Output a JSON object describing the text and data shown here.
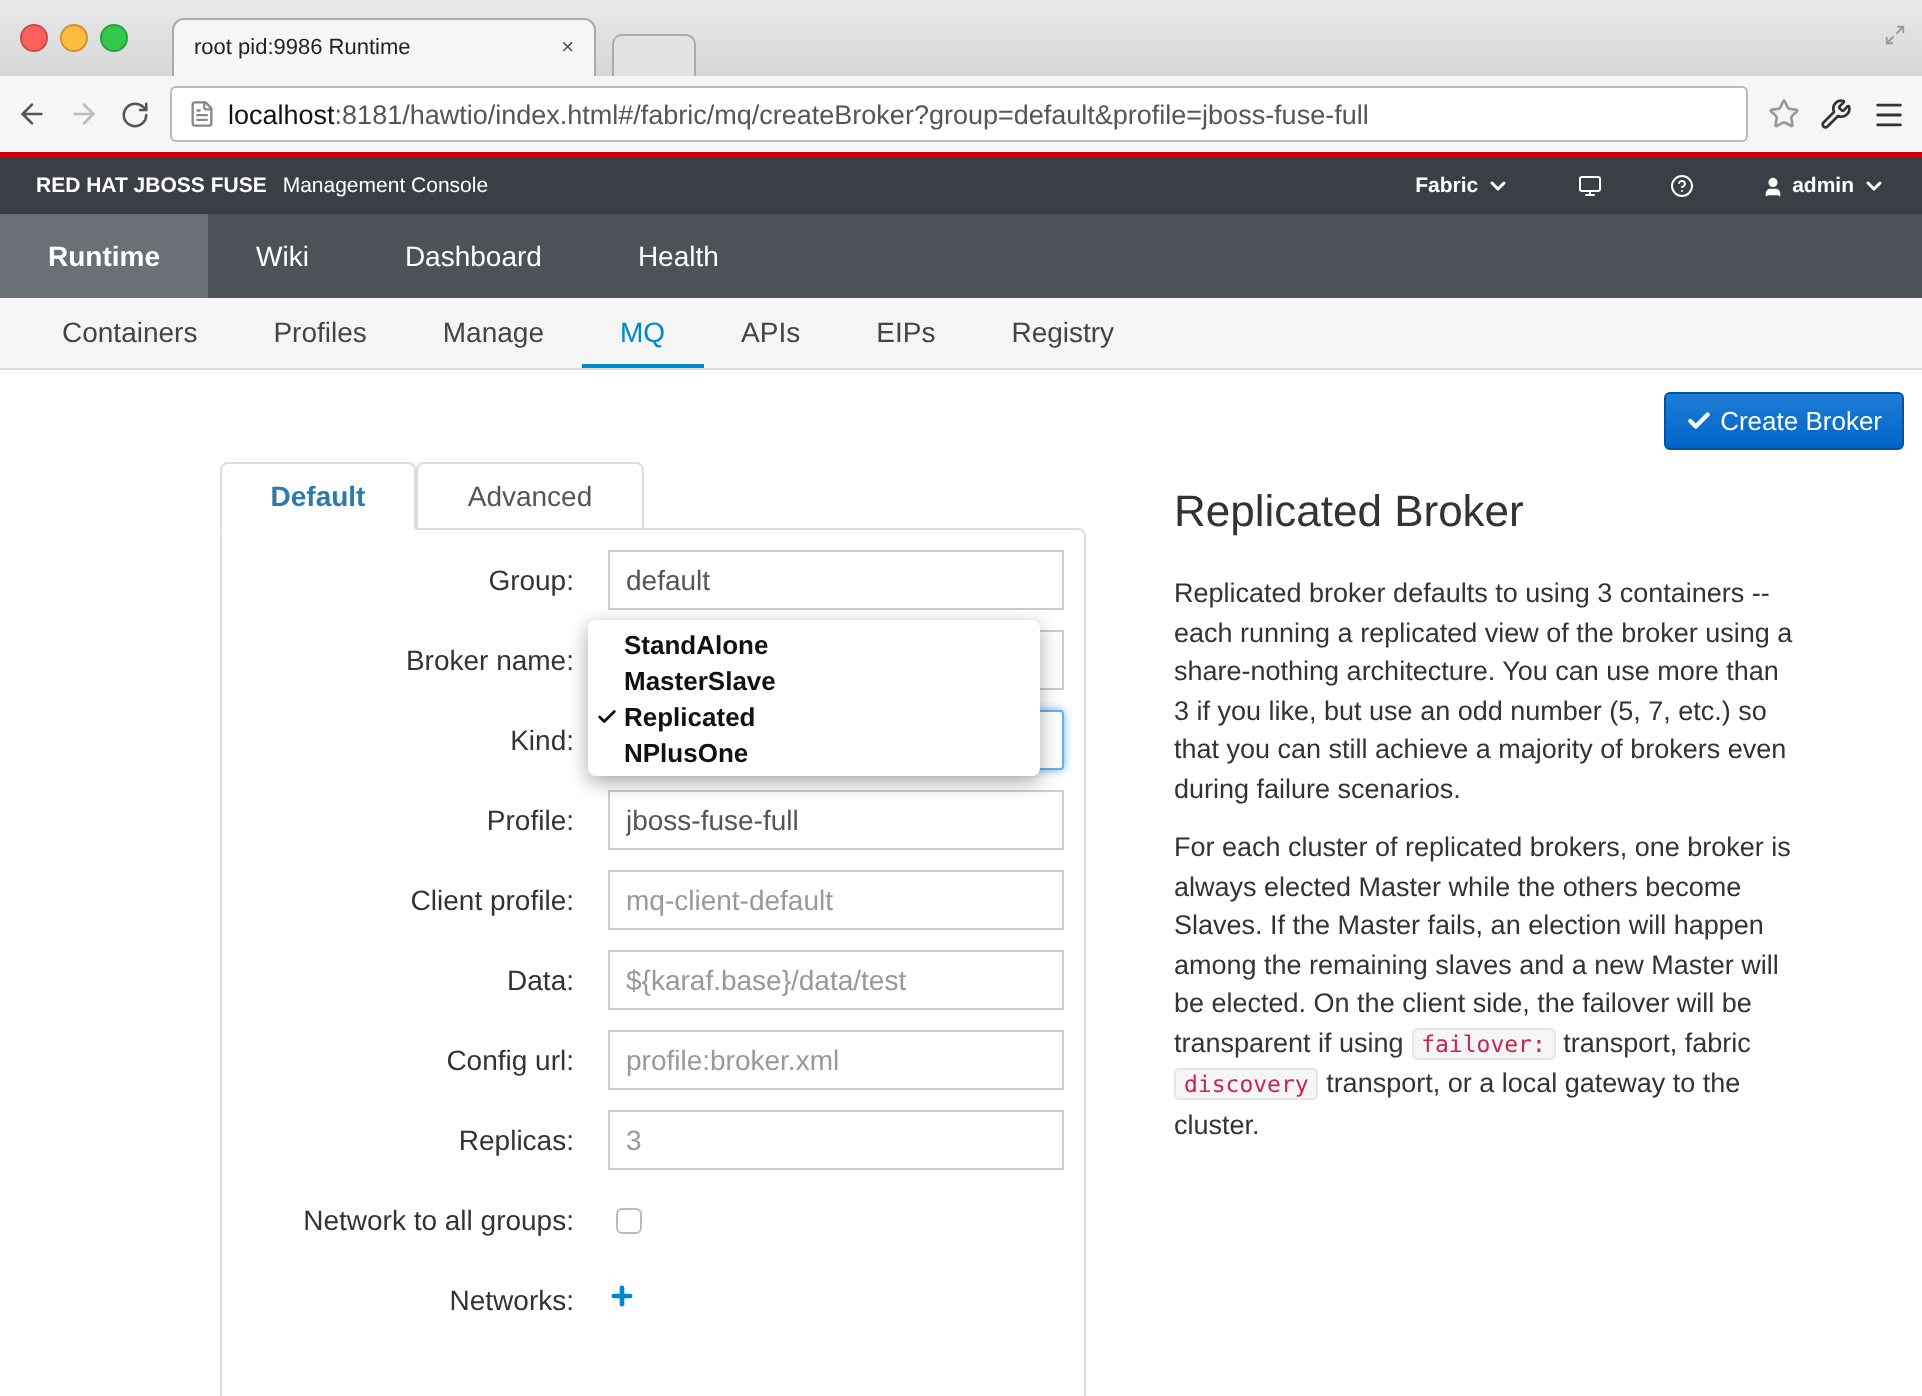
{
  "browser": {
    "tab_title": "root pid:9986 Runtime",
    "tab_close": "×",
    "url_host": "localhost",
    "url_rest": ":8181/hawtio/index.html#/fabric/mq/createBroker?group=default&profile=jboss-fuse-full"
  },
  "header": {
    "brand": "RED HAT JBOSS FUSE",
    "subtitle": "Management Console",
    "fabric_menu": "Fabric",
    "user_menu": "admin"
  },
  "nav": [
    {
      "label": "Runtime",
      "selected": true
    },
    {
      "label": "Wiki",
      "selected": false
    },
    {
      "label": "Dashboard",
      "selected": false
    },
    {
      "label": "Health",
      "selected": false
    }
  ],
  "subnav": [
    {
      "label": "Containers",
      "selected": false
    },
    {
      "label": "Profiles",
      "selected": false
    },
    {
      "label": "Manage",
      "selected": false
    },
    {
      "label": "MQ",
      "selected": true
    },
    {
      "label": "APIs",
      "selected": false
    },
    {
      "label": "EIPs",
      "selected": false
    },
    {
      "label": "Registry",
      "selected": false
    }
  ],
  "create_button": "Create Broker",
  "form_tabs": [
    {
      "label": "Default",
      "selected": true
    },
    {
      "label": "Advanced",
      "selected": false
    }
  ],
  "fields": [
    {
      "label": "Group:",
      "kind": "text",
      "value": "default"
    },
    {
      "label": "Broker name:",
      "kind": "text"
    },
    {
      "label": "Kind:",
      "kind": "select",
      "open": true,
      "options": [
        {
          "label": "StandAlone",
          "selected": false
        },
        {
          "label": "MasterSlave",
          "selected": false
        },
        {
          "label": "Replicated",
          "selected": true
        },
        {
          "label": "NPlusOne",
          "selected": false
        }
      ]
    },
    {
      "label": "Profile:",
      "kind": "text",
      "value": "jboss-fuse-full"
    },
    {
      "label": "Client profile:",
      "kind": "text",
      "placeholder": "mq-client-default"
    },
    {
      "label": "Data:",
      "kind": "text",
      "placeholder": "${karaf.base}/data/test"
    },
    {
      "label": "Config url:",
      "kind": "text",
      "placeholder": "profile:broker.xml"
    },
    {
      "label": "Replicas:",
      "kind": "text",
      "placeholder": "3"
    },
    {
      "label": "Network to all groups:",
      "kind": "checkbox",
      "checked": false
    },
    {
      "label": "Networks:",
      "kind": "add"
    }
  ],
  "help": {
    "title": "Replicated Broker",
    "paragraphs": [
      [
        {
          "kind": "text",
          "text": "Replicated broker defaults to using 3 containers -- each running a replicated view of the broker using a share-nothing architecture. You can use more than 3 if you like, but use an odd number (5, 7, etc.) so that you can still achieve a majority of brokers even during failure scenarios."
        }
      ],
      [
        {
          "kind": "text",
          "text": "For each cluster of replicated brokers, one broker is always elected Master while the others become Slaves. If the Master fails, an election will happen among the remaining slaves and a new Master will be elected. On the client side, the failover will be transparent if using "
        },
        {
          "kind": "code",
          "text": "failover:"
        },
        {
          "kind": "text",
          "text": " transport, fabric "
        },
        {
          "kind": "code",
          "text": "discovery"
        },
        {
          "kind": "text",
          "text": " transport, or a local gateway to the cluster."
        }
      ]
    ]
  }
}
